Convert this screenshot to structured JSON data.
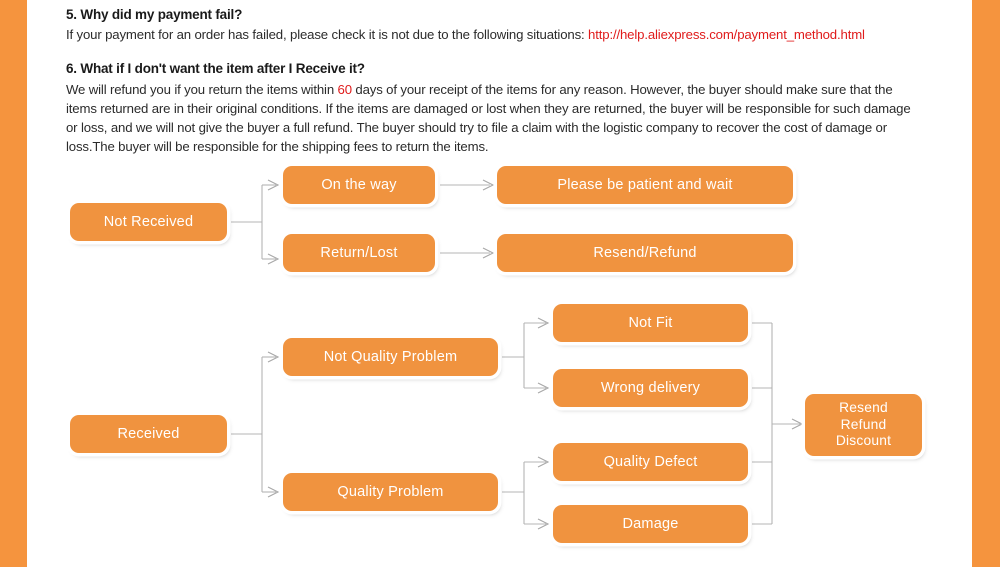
{
  "page": {
    "background_color": "#ffffff",
    "edge_bar_color": "#f5943e",
    "node_color": "#f0933f",
    "link_color": "#e01b1b",
    "connector_color": "#b4b4b4"
  },
  "sections": {
    "q5": {
      "heading": "5. Why did my payment fail?",
      "body_before": "If your payment for an order has failed, please check it is not due to the following  situations: ",
      "link": "http://help.aliexpress.com/payment_method.html"
    },
    "q6": {
      "heading": "6. What if I don't want the item after I Receive it?",
      "body_part1": "We will refund you if you return the items within ",
      "days": "60",
      "body_part2": " days of your receipt of the items for any reason. However, the buyer should make sure that the items returned are in their original conditions.  If the items are damaged or lost when they are returned, the buyer will be responsible for such damage or loss, and we will not give the buyer a full refund.  The buyer should try to file a claim with the logistic company to recover the cost of damage or loss.The buyer will be responsible for the shipping fees to return the items."
    }
  },
  "flowchart_not_received": {
    "root": "Not Received",
    "branches": [
      {
        "label": "On the way",
        "outcome": "Please be patient and wait"
      },
      {
        "label": "Return/Lost",
        "outcome": "Resend/Refund"
      }
    ]
  },
  "flowchart_received": {
    "root": "Received",
    "branches": [
      {
        "label": "Not Quality Problem",
        "reasons": [
          "Not Fit",
          "Wrong delivery"
        ]
      },
      {
        "label": "Quality Problem",
        "reasons": [
          "Quality Defect",
          "Damage"
        ]
      }
    ],
    "outcome": "Resend\nRefund\nDiscount",
    "outcome_lines": [
      "Resend",
      "Refund",
      "Discount"
    ]
  },
  "bottom_cut_text": ""
}
